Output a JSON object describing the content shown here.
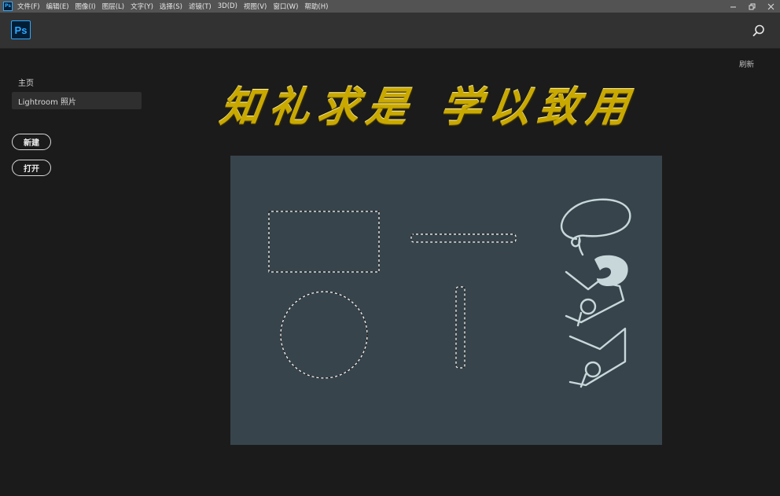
{
  "menubar": {
    "app_icon": "Ps",
    "items": [
      "文件(F)",
      "编辑(E)",
      "图像(I)",
      "图层(L)",
      "文字(Y)",
      "选择(S)",
      "滤镜(T)",
      "3D(D)",
      "视图(V)",
      "窗口(W)",
      "帮助(H)"
    ],
    "window_controls": [
      "minimize-icon",
      "restore-icon",
      "close-icon"
    ]
  },
  "header": {
    "logo": "Ps",
    "search_icon": "search-icon"
  },
  "sidebar": {
    "home_label": "主页",
    "lightroom_label": "Lightroom 照片",
    "new_button": "新建",
    "open_button": "打开"
  },
  "refresh_label": "刷新",
  "banner": {
    "chars": [
      "知",
      "礼",
      "求",
      "是",
      "学",
      "以",
      "致",
      "用"
    ],
    "color": "#c9a900"
  },
  "canvas": {
    "background": "#37444c",
    "stroke_color": "#c8d8da"
  }
}
